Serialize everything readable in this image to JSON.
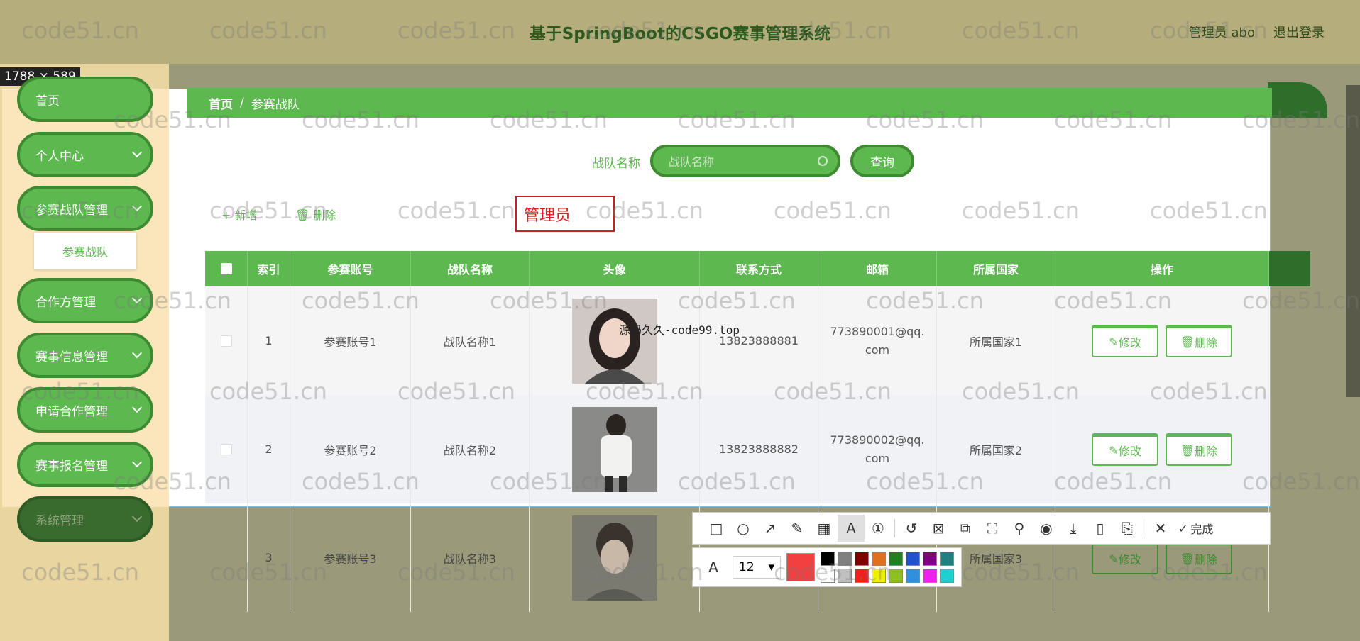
{
  "header": {
    "title": "基于SpringBoot的CSGO赛事管理系统",
    "user_label": "管理员 abo",
    "logout": "退出登录"
  },
  "selection_size": "1788 × 589",
  "sidebar": {
    "items": [
      {
        "label": "首页",
        "has_chevron": false
      },
      {
        "label": "个人中心",
        "has_chevron": true
      },
      {
        "label": "参赛战队管理",
        "has_chevron": true
      },
      {
        "label": "合作方管理",
        "has_chevron": true
      },
      {
        "label": "赛事信息管理",
        "has_chevron": true
      },
      {
        "label": "申请合作管理",
        "has_chevron": true
      },
      {
        "label": "赛事报名管理",
        "has_chevron": true
      },
      {
        "label": "系统管理",
        "has_chevron": true
      }
    ],
    "submenu": {
      "label": "参赛战队"
    }
  },
  "breadcrumb": {
    "home": "首页",
    "separator": "/",
    "current": "参赛战队"
  },
  "search": {
    "label": "战队名称",
    "placeholder": "战队名称",
    "button": "查询"
  },
  "actions": {
    "add": "+ 新增",
    "delete": "删除"
  },
  "annotation_text": "管理员",
  "overlay_text": "源码久久-code99.top",
  "table": {
    "headers": [
      "",
      "索引",
      "参赛账号",
      "战队名称",
      "头像",
      "联系方式",
      "邮箱",
      "所属国家",
      "操作"
    ],
    "edit_label": "修改",
    "delete_label": "删除",
    "rows": [
      {
        "index": "1",
        "account": "参赛账号1",
        "team": "战队名称1",
        "phone": "13823888881",
        "email": "773890001@qq.com",
        "country": "所属国家1"
      },
      {
        "index": "2",
        "account": "参赛账号2",
        "team": "战队名称2",
        "phone": "13823888882",
        "email": "773890002@qq.com",
        "country": "所属国家2"
      },
      {
        "index": "3",
        "account": "参赛账号3",
        "team": "战队名称3",
        "phone": "",
        "email": "",
        "country": "所属国家3"
      }
    ]
  },
  "toolbar": {
    "done": "完成",
    "font_size": "12",
    "current_color": "#f24040",
    "palette": [
      "#000000",
      "#808080",
      "#800000",
      "#e07020",
      "#208020",
      "#2050d0",
      "#800080",
      "#208080",
      "#ffffff",
      "#c0c0c0",
      "#f02020",
      "#f0f000",
      "#90c020",
      "#3090e0",
      "#f020f0",
      "#20d0d0"
    ]
  },
  "watermark": "code51.cn",
  "colors": {
    "accent": "#5cb84f",
    "accent_dark": "#3d8a31"
  }
}
